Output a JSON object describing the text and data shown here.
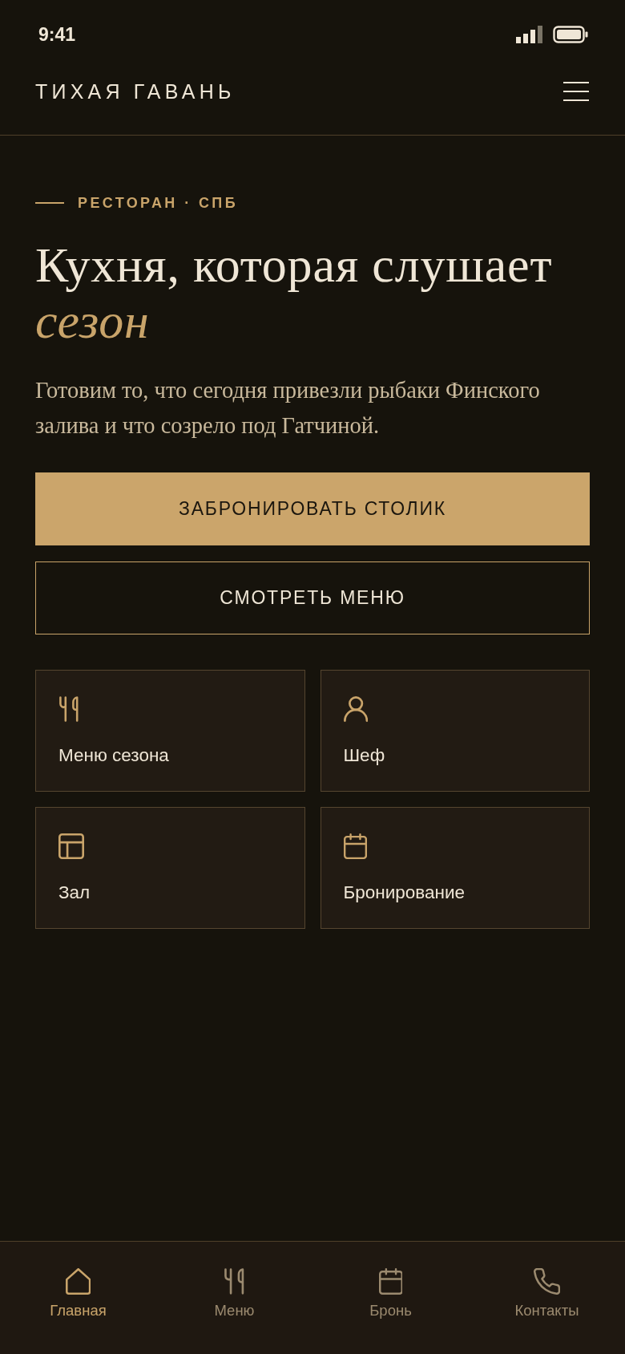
{
  "status_bar": {
    "time": "9:41"
  },
  "header": {
    "title": "ТИХАЯ ГАВАНЬ"
  },
  "hero": {
    "eyebrow": "РЕСТОРАН · СПБ",
    "headline": "Кухня, которая слушает *сезон*",
    "description": "Готовим то, что сегодня привезли рыбаки Финского залива и что созрело под Гатчиной."
  },
  "actions": [
    {
      "label": "ЗАБРОНИРОВАТЬ СТОЛИК",
      "kind": "primary"
    },
    {
      "label": "СМОТРЕТЬ МЕНЮ",
      "kind": "secondary"
    }
  ],
  "tiles": [
    {
      "label": "Меню сезона"
    },
    {
      "label": "Шеф"
    },
    {
      "label": "Зал"
    },
    {
      "label": "Бронирование"
    }
  ],
  "bottom_nav": [
    {
      "label": "Главная",
      "selected": true
    },
    {
      "label": "Меню",
      "selected": false
    },
    {
      "label": "Бронь",
      "selected": false
    },
    {
      "label": "Контакты",
      "selected": false
    }
  ]
}
